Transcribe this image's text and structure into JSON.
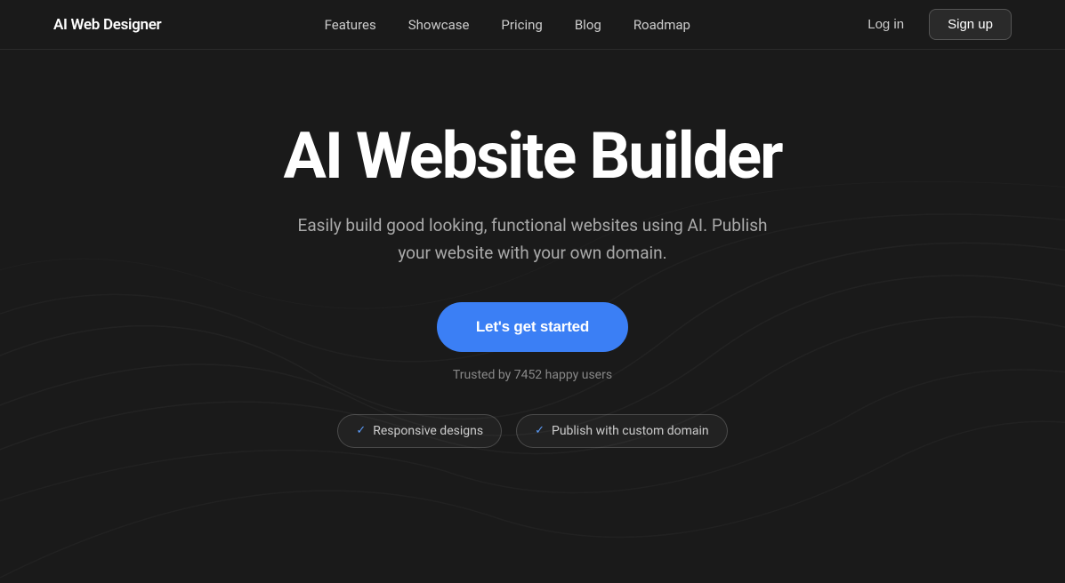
{
  "brand": {
    "name": "AI Web Designer"
  },
  "nav": {
    "links": [
      {
        "label": "Features",
        "id": "features"
      },
      {
        "label": "Showcase",
        "id": "showcase"
      },
      {
        "label": "Pricing",
        "id": "pricing"
      },
      {
        "label": "Blog",
        "id": "blog"
      },
      {
        "label": "Roadmap",
        "id": "roadmap"
      }
    ],
    "login_label": "Log in",
    "signup_label": "Sign up"
  },
  "hero": {
    "title": "AI Website Builder",
    "subtitle": "Easily build good looking, functional websites using AI. Publish your website with your own domain.",
    "cta_label": "Let's get started",
    "trusted_text": "Trusted by 7452 happy users"
  },
  "badges": [
    {
      "label": "Responsive designs",
      "check": "✓"
    },
    {
      "label": "Publish with custom domain",
      "check": "✓"
    }
  ]
}
